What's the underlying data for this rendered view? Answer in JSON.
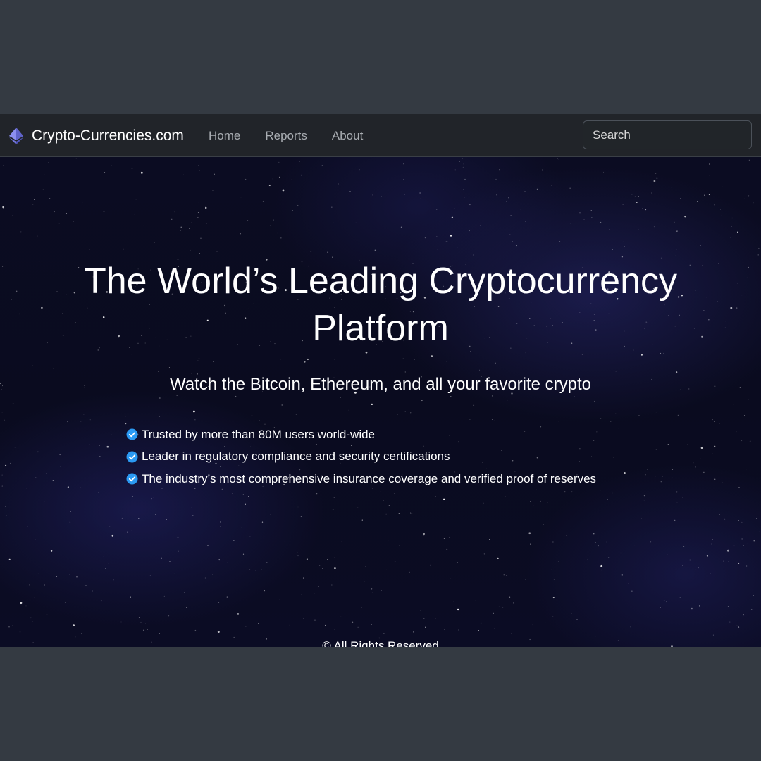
{
  "navbar": {
    "brand": {
      "icon": "ethereum-diamond-icon",
      "name": "Crypto-Currencies.com"
    },
    "links": [
      {
        "label": "Home"
      },
      {
        "label": "Reports"
      },
      {
        "label": "About"
      }
    ],
    "search": {
      "placeholder": "Search",
      "value": ""
    }
  },
  "hero": {
    "title": "The World’s Leading Cryptocurrency Platform",
    "subtitle": "Watch the Bitcoin, Ethereum, and all your favorite crypto",
    "features": [
      {
        "icon": "check-badge-icon",
        "text": "Trusted by more than 80M users world-wide"
      },
      {
        "icon": "check-badge-icon",
        "text": "Leader in regulatory compliance and security certifications"
      },
      {
        "icon": "check-badge-icon",
        "text": "The industry’s most comprehensive insurance coverage and verified proof of reserves"
      }
    ]
  },
  "footer": {
    "copyright": "© All Rights Reserved"
  },
  "colors": {
    "page_background": "#343a42",
    "navbar_background": "#212429",
    "nav_link": "#a9adb2",
    "hero_background": "#0b0c22",
    "check_badge": "#2b9af3",
    "brand_icon": "#7b7fe0"
  }
}
